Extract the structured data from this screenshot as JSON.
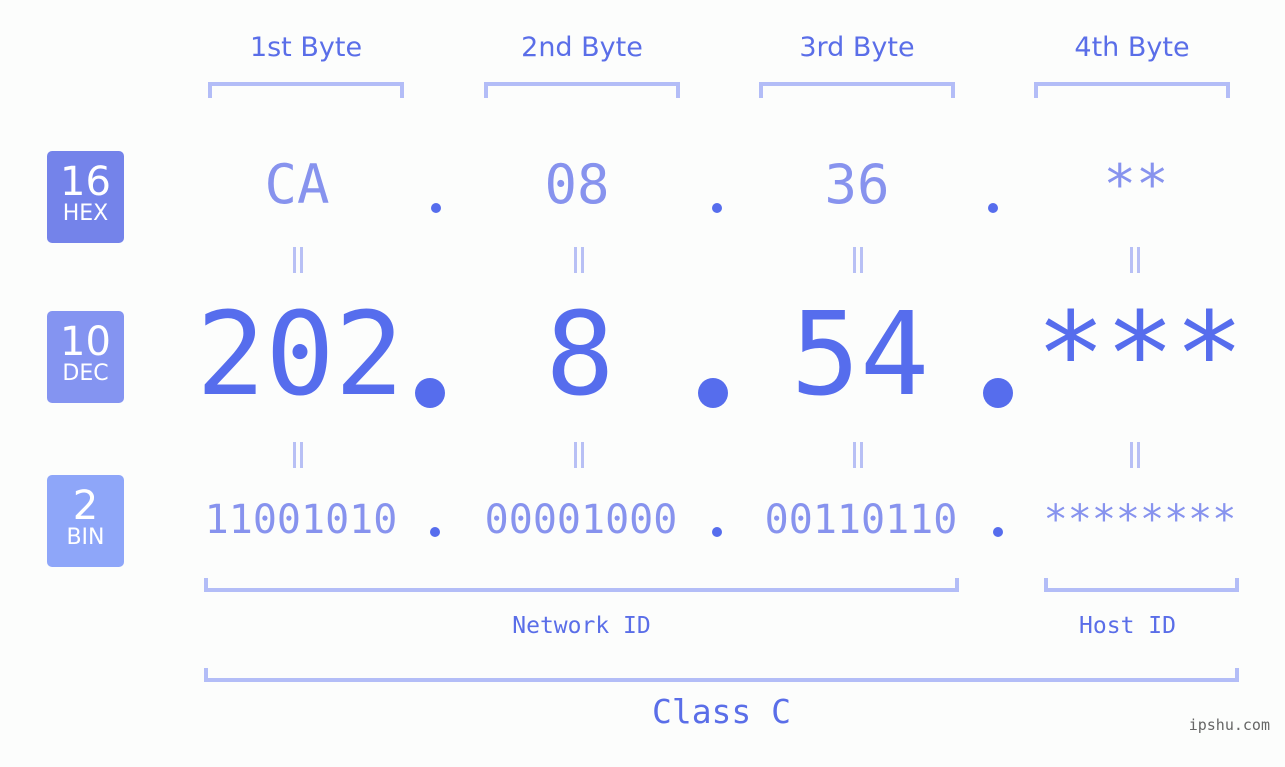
{
  "colors": {
    "accent": "#566ded",
    "hex_badge": "#7483ea",
    "dec_badge": "#8494f1",
    "bin_badge": "#8ea6f9",
    "bracket": "#b3bdf7",
    "light_text": "#8793ee",
    "watermark": "#666666",
    "background": "#fcfdfc"
  },
  "badges": [
    {
      "num": "16",
      "label": "HEX"
    },
    {
      "num": "10",
      "label": "DEC"
    },
    {
      "num": "2",
      "label": "BIN"
    }
  ],
  "bytes": [
    {
      "label": "1st Byte",
      "hex": "CA",
      "dec": "202",
      "bin": "11001010"
    },
    {
      "label": "2nd Byte",
      "hex": "08",
      "dec": "8",
      "bin": "00001000"
    },
    {
      "label": "3rd Byte",
      "hex": "36",
      "dec": "54",
      "bin": "00110110"
    },
    {
      "label": "4th Byte",
      "hex": "**",
      "dec": "***",
      "bin": "********"
    }
  ],
  "network_id_label": "Network ID",
  "host_id_label": "Host ID",
  "class_label": "Class C",
  "watermark": "ipshu.com"
}
